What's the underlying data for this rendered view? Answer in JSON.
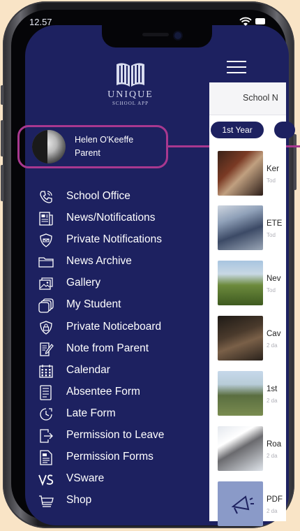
{
  "status": {
    "time": "12.57"
  },
  "logo": {
    "name": "UNIQUE",
    "subtitle": "SCHOOL APP"
  },
  "profile": {
    "name": "Helen O'Keeffe",
    "role": "Parent"
  },
  "menu": {
    "items": [
      {
        "label": "School Office",
        "icon": "phone-icon"
      },
      {
        "label": "News/Notifications",
        "icon": "newspaper-icon"
      },
      {
        "label": "Private Notifications",
        "icon": "shield-icon"
      },
      {
        "label": "News Archive",
        "icon": "folder-icon"
      },
      {
        "label": "Gallery",
        "icon": "gallery-icon"
      },
      {
        "label": "My Student",
        "icon": "stack-icon"
      },
      {
        "label": "Private Noticeboard",
        "icon": "shield-lock-icon"
      },
      {
        "label": "Note from Parent",
        "icon": "note-icon"
      },
      {
        "label": "Calendar",
        "icon": "calendar-icon"
      },
      {
        "label": "Absentee Form",
        "icon": "form-icon"
      },
      {
        "label": "Late Form",
        "icon": "clock-icon"
      },
      {
        "label": "Permission to Leave",
        "icon": "exit-icon"
      },
      {
        "label": "Permission Forms",
        "icon": "document-icon"
      },
      {
        "label": "VSware",
        "icon": "vsware-icon"
      },
      {
        "label": "Shop",
        "icon": "cart-icon"
      }
    ]
  },
  "panel": {
    "title": "School N",
    "chips": [
      "1st Year",
      ""
    ],
    "news": [
      {
        "title": "Ker",
        "sub": "Tod"
      },
      {
        "title": "ETE",
        "sub": "Tod"
      },
      {
        "title": "Nev",
        "sub": "Tod"
      },
      {
        "title": "Cav",
        "sub": "2 da"
      },
      {
        "title": "1st",
        "sub": "2 da"
      },
      {
        "title": "Roa",
        "sub": "2 da"
      },
      {
        "title": "PDF",
        "sub": "2 da"
      }
    ]
  },
  "colors": {
    "navy": "#1d2160",
    "magenta": "#a8388f",
    "backdrop": "#f9e4c6"
  }
}
